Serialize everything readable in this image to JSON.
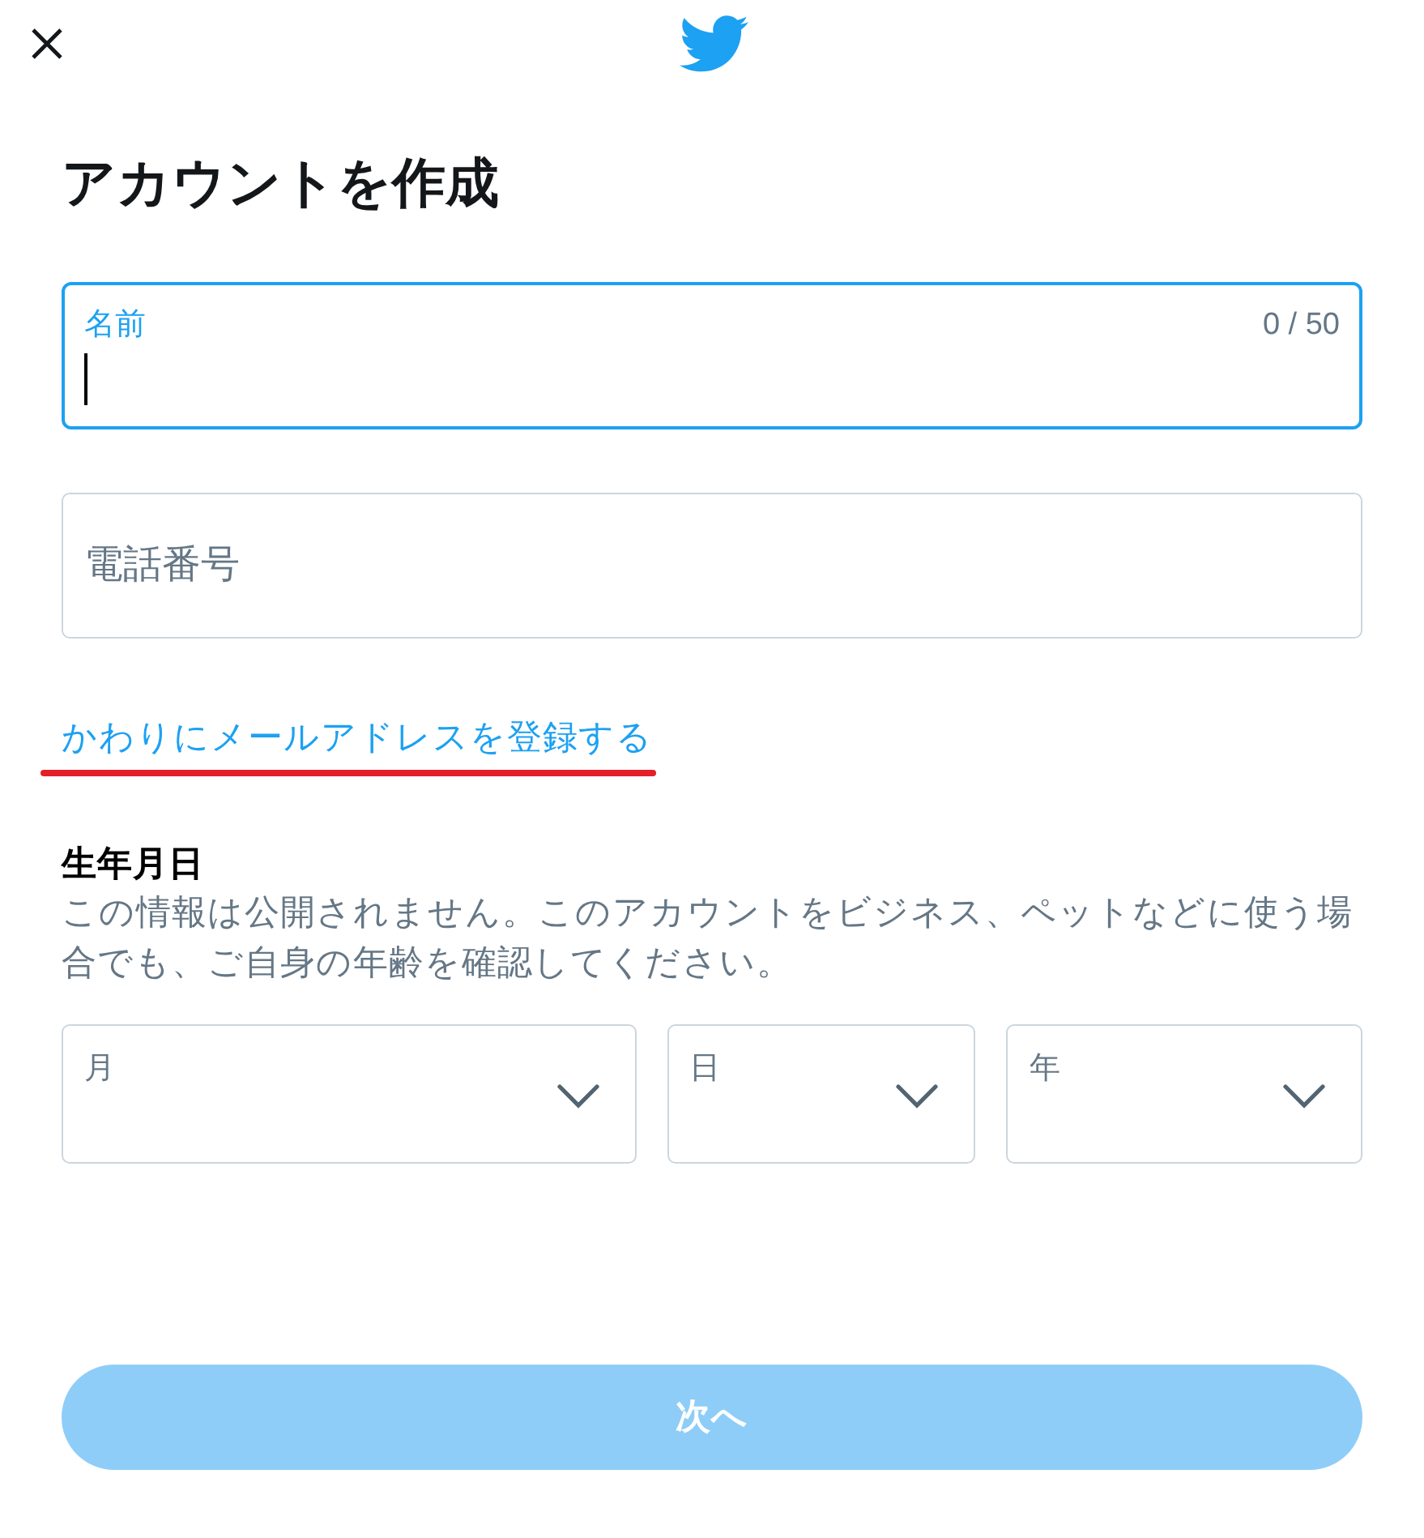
{
  "title": "アカウントを作成",
  "fields": [
    {
      "label": "名前",
      "counter": "0 / 50",
      "focused": true
    },
    {
      "label": "電話番号",
      "focused": false
    }
  ],
  "link": {
    "text": "かわりにメールアドレスを登録する",
    "marked": true
  },
  "birthday": {
    "title": "生年月日",
    "description": "この情報は公開されません。このアカウントをビジネス、ペットなどに使う場合でも、ご自身の年齢を確認してください。",
    "dropdowns": [
      {
        "label": "月"
      },
      {
        "label": "日"
      },
      {
        "label": "年"
      }
    ]
  },
  "next_button": {
    "label": "次へ",
    "disabled": true
  }
}
